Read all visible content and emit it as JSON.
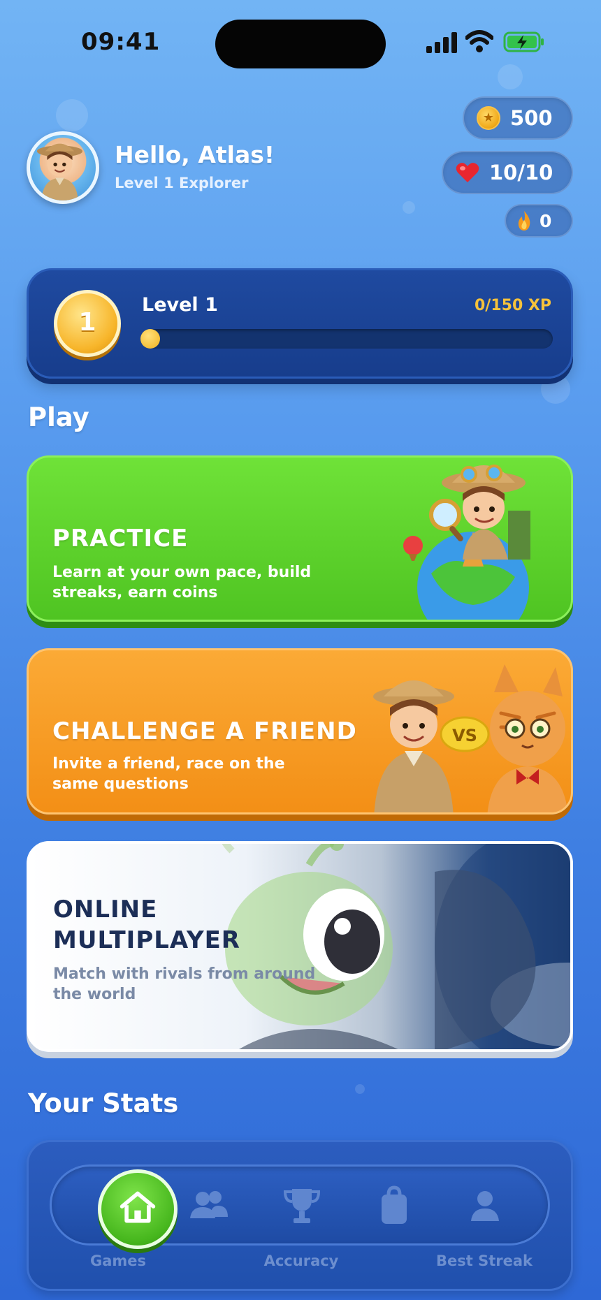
{
  "status_bar": {
    "time": "09:41"
  },
  "header": {
    "greeting": "Hello, Atlas!",
    "subtitle": "Level 1 Explorer",
    "avatar_icon": "explorer-avatar"
  },
  "currency": {
    "coins": "500",
    "hearts": "10/10",
    "streak": "0"
  },
  "level": {
    "badge": "1",
    "title": "Level 1",
    "xp_label": "0/150 XP",
    "xp_progress": 0
  },
  "play": {
    "section_title": "Play",
    "cards": [
      {
        "title": "PRACTICE",
        "description": "Learn at your own pace, build streaks, earn coins",
        "color": "#58cc2a"
      },
      {
        "title": "CHALLENGE A FRIEND",
        "description": "Invite a friend, race on the same questions",
        "vs_label": "VS",
        "color": "#f59b20"
      },
      {
        "title": "ONLINE MULTIPLAYER",
        "description": "Match with rivals from around the world",
        "color": "#ffffff"
      }
    ]
  },
  "stats": {
    "section_title": "Your Stats",
    "nav": [
      {
        "icon": "home-icon",
        "label": "Games"
      },
      {
        "icon": "friends-icon",
        "label": ""
      },
      {
        "icon": "trophy-icon",
        "label": "Accuracy"
      },
      {
        "icon": "bag-icon",
        "label": ""
      },
      {
        "icon": "profile-icon",
        "label": "Best Streak"
      }
    ]
  }
}
